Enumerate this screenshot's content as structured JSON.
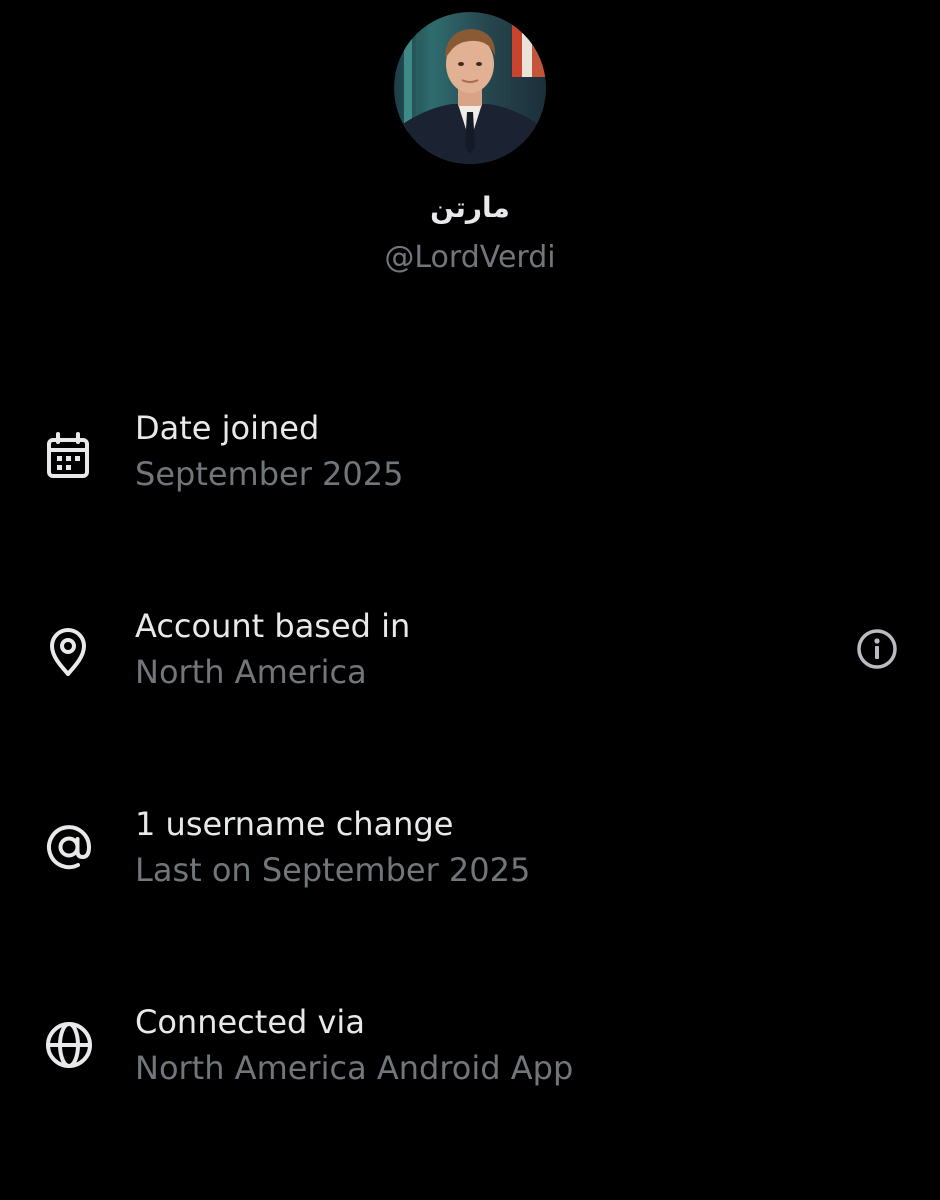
{
  "profile": {
    "display_name": "مارتن",
    "handle": "@LordVerdi",
    "avatar_icon": "avatar-portrait"
  },
  "rows": [
    {
      "label": "Date joined",
      "value": "September 2025",
      "icon": "calendar-icon"
    },
    {
      "label": "Account based in",
      "value": "North America",
      "icon": "location-pin-icon",
      "info_icon": "info-icon"
    },
    {
      "label": "1 username change",
      "value": "Last on September 2025",
      "icon": "at-sign-icon"
    },
    {
      "label": "Connected via",
      "value": "North America Android App",
      "icon": "globe-icon"
    }
  ],
  "colors": {
    "background": "#000000",
    "primary_text": "#e7e9ea",
    "secondary_text": "#71767b"
  }
}
